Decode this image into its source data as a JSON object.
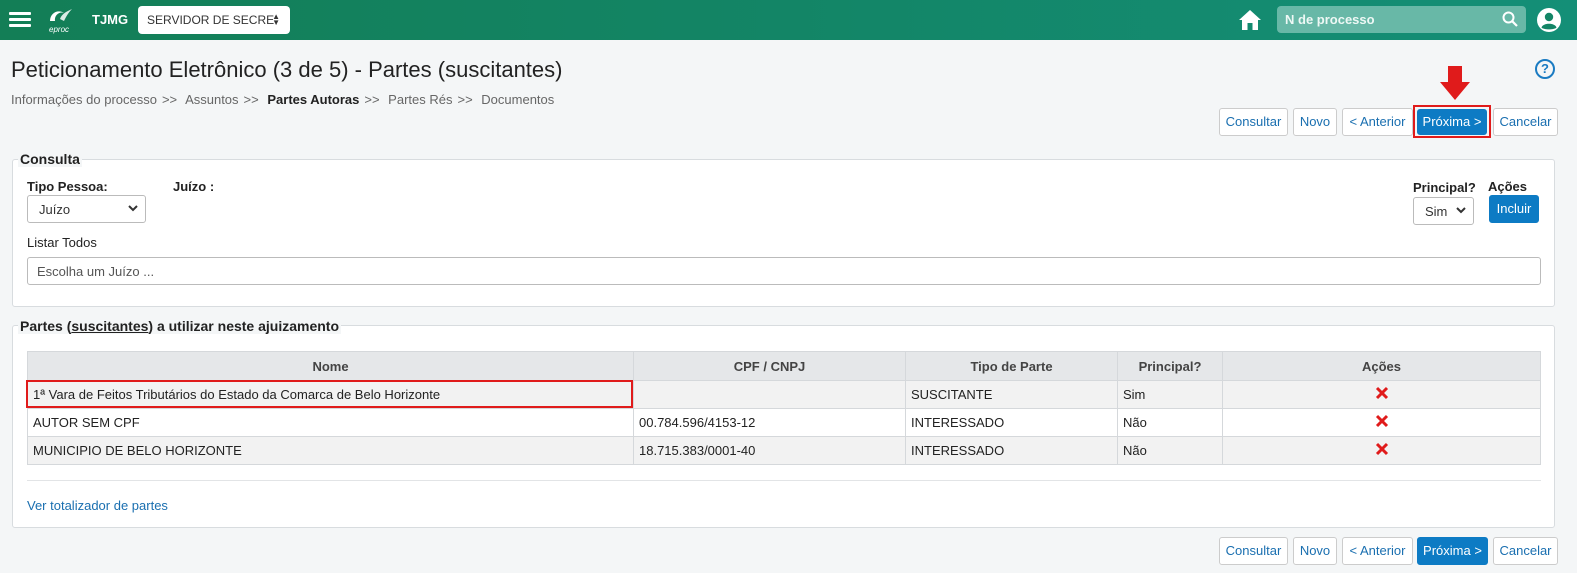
{
  "topbar": {
    "logo_text": "eproc",
    "org": "TJMG",
    "role_select": "SERVIDOR DE SECRE",
    "search_placeholder": "N de processo"
  },
  "header": {
    "title": "Peticionamento Eletrônico (3 de 5) - Partes (suscitantes)",
    "help": "?",
    "breadcrumb": [
      "Informações do processo",
      "Assuntos",
      "Partes Autoras",
      "Partes Rés",
      "Documentos"
    ],
    "breadcrumb_sep": ">>"
  },
  "actions": {
    "consultar": "Consultar",
    "novo": "Novo",
    "anterior": "< Anterior",
    "proxima": "Próxima >",
    "cancelar": "Cancelar"
  },
  "consulta": {
    "legend": "Consulta",
    "tipo_pessoa_label": "Tipo Pessoa:",
    "tipo_pessoa_value": "Juízo",
    "juizo_label": "Juízo :",
    "principal_label": "Principal?",
    "principal_value": "Sim",
    "acoes_label": "Ações",
    "incluir": "Incluir",
    "listar_todos": "Listar Todos",
    "juizo_placeholder": "Escolha um Juízo ..."
  },
  "partes": {
    "legend_prefix": "Partes (",
    "legend_underlined": "suscitantes",
    "legend_suffix": ") a utilizar neste ajuizamento",
    "columns": [
      "Nome",
      "CPF / CNPJ",
      "Tipo de Parte",
      "Principal?",
      "Ações"
    ],
    "rows": [
      {
        "nome": "1ª Vara de Feitos Tributários do Estado da Comarca de Belo Horizonte",
        "cpf": "",
        "tipo": "SUSCITANTE",
        "principal": "Sim"
      },
      {
        "nome": "AUTOR SEM CPF",
        "cpf": "00.784.596/4153-12",
        "tipo": "INTERESSADO",
        "principal": "Não"
      },
      {
        "nome": "MUNICIPIO DE BELO HORIZONTE",
        "cpf": "18.715.383/0001-40",
        "tipo": "INTERESSADO",
        "principal": "Não"
      }
    ],
    "totalizador_link": "Ver totalizador de partes"
  },
  "colors": {
    "topbar": "#138566",
    "primary": "#0d7bc4",
    "link": "#1a6fb0",
    "highlight": "#e01b1b"
  },
  "icons": [
    "menu-icon",
    "eproc-logo",
    "home-icon",
    "search-icon",
    "user-icon",
    "help-icon",
    "arrow-down-icon",
    "delete-icon"
  ]
}
